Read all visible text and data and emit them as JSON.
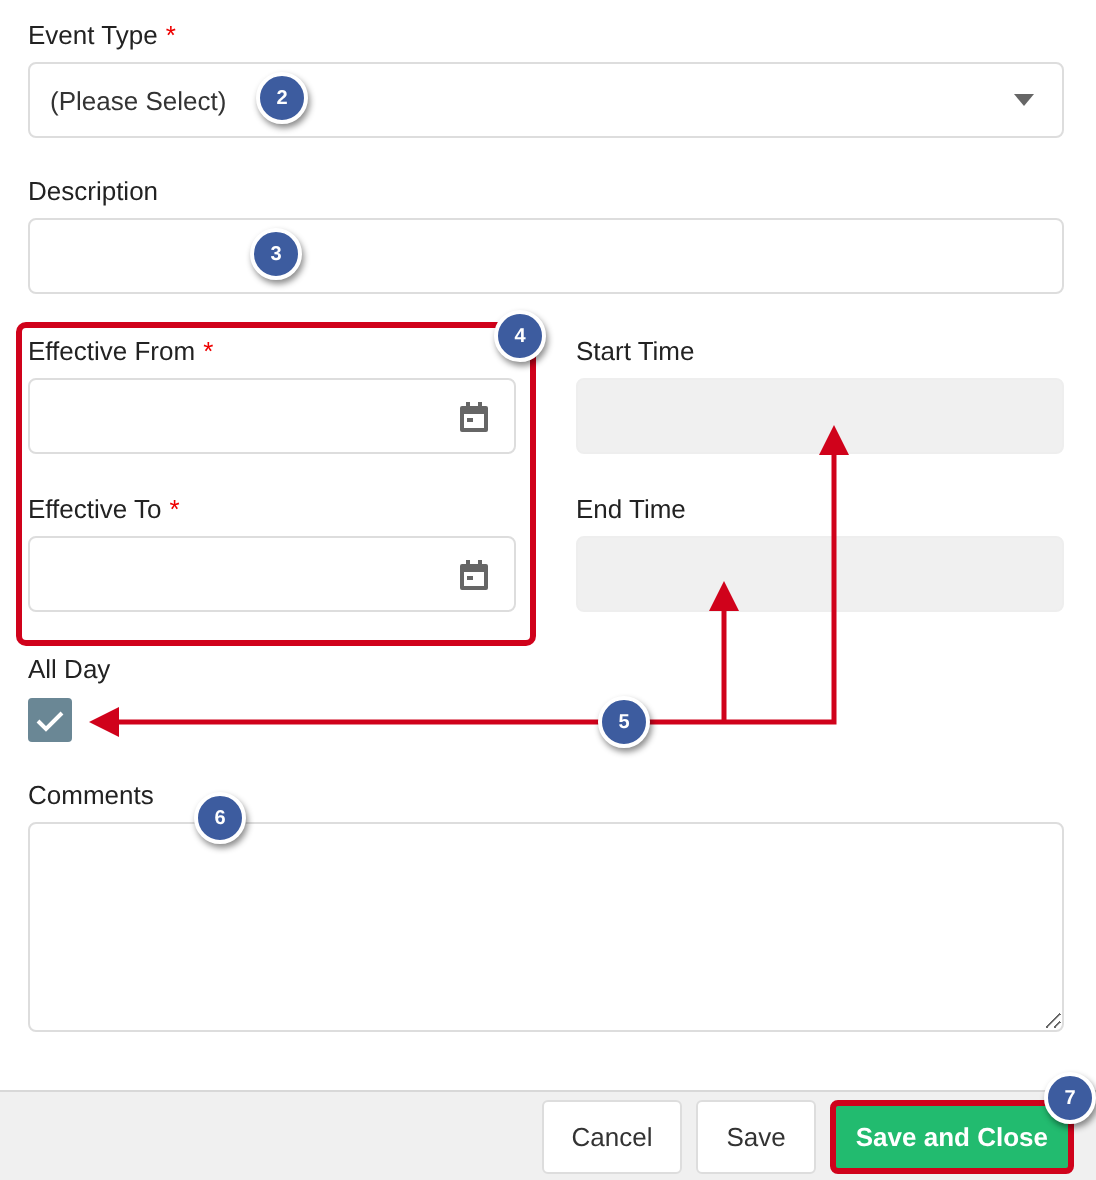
{
  "fields": [
    {
      "kind": "select",
      "label": "Event Type",
      "required_mark": "*",
      "value": "(Please Select)"
    },
    {
      "kind": "text",
      "label": "Description"
    }
  ],
  "date_range": {
    "highlighted": true,
    "fields": [
      {
        "kind": "date",
        "label": "Effective From",
        "required_mark": "*"
      },
      {
        "kind": "date",
        "label": "Effective To",
        "required_mark": "*"
      }
    ]
  },
  "time_fields": [
    {
      "kind": "text",
      "label": "Start Time",
      "disabled": true
    },
    {
      "kind": "text",
      "label": "End Time",
      "disabled": true
    }
  ],
  "all_day": {
    "label": "All Day",
    "checked": true
  },
  "comments": {
    "label": "Comments"
  },
  "footer_buttons": [
    {
      "label": "Cancel",
      "kind": "default",
      "highlighted": false
    },
    {
      "label": "Save",
      "kind": "default",
      "highlighted": false
    },
    {
      "label": "Save and Close",
      "kind": "primary",
      "highlighted": true
    }
  ],
  "callouts": [
    {
      "label": "2"
    },
    {
      "label": "3"
    },
    {
      "label": "4"
    },
    {
      "label": "5"
    },
    {
      "label": "6"
    },
    {
      "label": "7"
    }
  ]
}
